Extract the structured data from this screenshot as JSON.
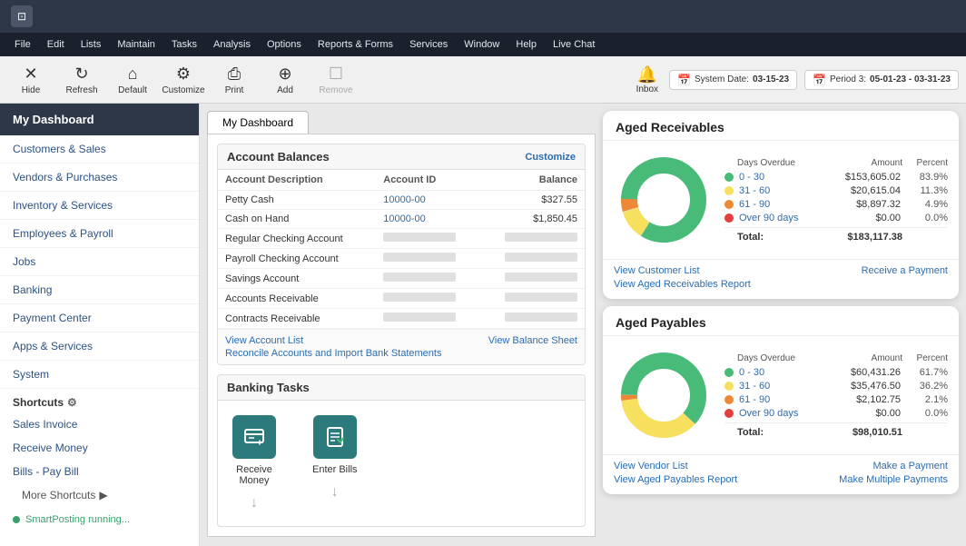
{
  "titleBar": {
    "appIcon": "⊡"
  },
  "menuBar": {
    "items": [
      "File",
      "Edit",
      "Lists",
      "Maintain",
      "Tasks",
      "Analysis",
      "Options",
      "Reports & Forms",
      "Services",
      "Window",
      "Help",
      "Live Chat"
    ]
  },
  "toolbar": {
    "buttons": [
      {
        "id": "hide",
        "label": "Hide",
        "icon": "✕",
        "disabled": false
      },
      {
        "id": "refresh",
        "label": "Refresh",
        "icon": "↻",
        "disabled": false
      },
      {
        "id": "default",
        "label": "Default",
        "icon": "⌂",
        "disabled": false
      },
      {
        "id": "customize",
        "label": "Customize",
        "icon": "⚙",
        "disabled": false
      },
      {
        "id": "print",
        "label": "Print",
        "icon": "⎙",
        "disabled": false
      },
      {
        "id": "add",
        "label": "Add",
        "icon": "⊕",
        "disabled": false
      },
      {
        "id": "remove",
        "label": "Remove",
        "icon": "☐",
        "disabled": true
      }
    ],
    "inbox": {
      "label": "Inbox",
      "icon": "🔔"
    },
    "systemDate": {
      "label": "System Date:",
      "value": "03-15-23",
      "icon": "📅"
    },
    "period": {
      "label": "Period 3:",
      "value": "05-01-23 - 03-31-23",
      "icon": "📅"
    }
  },
  "sidebar": {
    "header": "My Dashboard",
    "navItems": [
      "Customers & Sales",
      "Vendors & Purchases",
      "Inventory & Services",
      "Employees & Payroll",
      "Jobs",
      "Banking",
      "Payment Center",
      "Apps & Services",
      "System"
    ],
    "shortcuts": {
      "label": "Shortcuts",
      "items": [
        "Sales Invoice",
        "Receive Money",
        "Bills - Pay Bill"
      ],
      "more": "More Shortcuts"
    },
    "smartPosting": "SmartPosting running..."
  },
  "dashboard": {
    "tabLabel": "My Dashboard",
    "accountBalances": {
      "title": "Account Balances",
      "customizeLabel": "Customize",
      "columns": [
        "Account Description",
        "Account ID",
        "Balance"
      ],
      "rows": [
        {
          "desc": "Petty Cash",
          "id": "10000-00",
          "balance": "$327.55"
        },
        {
          "desc": "Cash on Hand",
          "id": "10000-00",
          "balance": "$1,850.45"
        },
        {
          "desc": "Regular Checking Account",
          "id": "",
          "balance": ""
        },
        {
          "desc": "Payroll Checking Account",
          "id": "",
          "balance": ""
        },
        {
          "desc": "Savings Account",
          "id": "",
          "balance": ""
        },
        {
          "desc": "Accounts Receivable",
          "id": "",
          "balance": ""
        },
        {
          "desc": "Contracts Receivable",
          "id": "",
          "balance": ""
        }
      ],
      "footer": {
        "viewAccountList": "View Account List",
        "viewBalanceSheet": "View Balance Sheet",
        "reconcile": "Reconcile Accounts and Import Bank Statements"
      }
    },
    "bankingTasks": {
      "title": "Banking Tasks",
      "tasks": [
        {
          "label": "Receive\nMoney",
          "icon": "📥"
        },
        {
          "label": "Enter Bills",
          "icon": "📄"
        }
      ]
    }
  },
  "agedReceivables": {
    "title": "Aged Receivables",
    "columns": [
      "Days Overdue",
      "Amount",
      "Percent"
    ],
    "rows": [
      {
        "label": "0 - 30",
        "color": "#48bb78",
        "amount": "$153,605.02",
        "percent": "83.9%"
      },
      {
        "label": "31 - 60",
        "color": "#f6e05e",
        "amount": "$20,615.04",
        "percent": "11.3%"
      },
      {
        "label": "61 - 90",
        "color": "#ed8936",
        "amount": "$8,897.32",
        "percent": "4.9%"
      },
      {
        "label": "Over 90 days",
        "color": "#e53e3e",
        "amount": "$0.00",
        "percent": "0.0%"
      }
    ],
    "total": {
      "label": "Total:",
      "amount": "$183,117.38"
    },
    "donut": {
      "segments": [
        {
          "value": 83.9,
          "color": "#48bb78"
        },
        {
          "value": 11.3,
          "color": "#f6e05e"
        },
        {
          "value": 4.9,
          "color": "#ed8936"
        },
        {
          "value": 0.0,
          "color": "#e53e3e"
        }
      ]
    },
    "footer": {
      "viewCustomerList": "View Customer List",
      "viewAgedReport": "View Aged Receivables Report",
      "receivePayment": "Receive a Payment"
    }
  },
  "agedPayables": {
    "title": "Aged Payables",
    "columns": [
      "Days Overdue",
      "Amount",
      "Percent"
    ],
    "rows": [
      {
        "label": "0 - 30",
        "color": "#48bb78",
        "amount": "$60,431.26",
        "percent": "61.7%"
      },
      {
        "label": "31 - 60",
        "color": "#f6e05e",
        "amount": "$35,476.50",
        "percent": "36.2%"
      },
      {
        "label": "61 - 90",
        "color": "#ed8936",
        "amount": "$2,102.75",
        "percent": "2.1%"
      },
      {
        "label": "Over 90 days",
        "color": "#e53e3e",
        "amount": "$0.00",
        "percent": "0.0%"
      }
    ],
    "total": {
      "label": "Total:",
      "amount": "$98,010.51"
    },
    "donut": {
      "segments": [
        {
          "value": 61.7,
          "color": "#48bb78"
        },
        {
          "value": 36.2,
          "color": "#f6e05e"
        },
        {
          "value": 2.1,
          "color": "#ed8936"
        },
        {
          "value": 0.0,
          "color": "#e53e3e"
        }
      ]
    },
    "footer": {
      "viewVendorList": "View Vendor List",
      "viewAgedReport": "View Aged Payables Report",
      "makePayment": "Make a Payment",
      "multiplePayments": "Make Multiple Payments"
    }
  }
}
